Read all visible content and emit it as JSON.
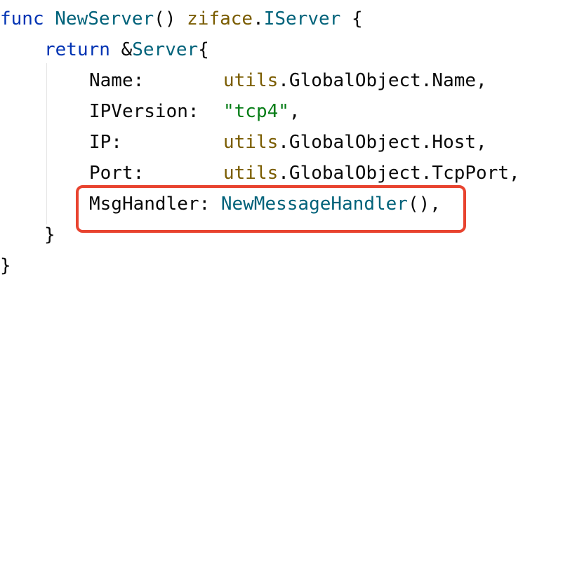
{
  "code": {
    "line1": {
      "kw_func": "func",
      "fn_name": "NewServer",
      "parens": "()",
      "pkg": "ziface",
      "dot": ".",
      "type": "IServer",
      "brace": "{"
    },
    "line2": {
      "kw_return": "return",
      "amp": "&",
      "type": "Server",
      "brace": "{"
    },
    "line3": {
      "field": "Name:",
      "pkg": "utils",
      "rest": ".GlobalObject.Name,"
    },
    "line4": {
      "field": "IPVersion:",
      "str": "\"tcp4\"",
      "comma": ","
    },
    "line5": {
      "field": "IP:",
      "pkg": "utils",
      "rest": ".GlobalObject.Host,"
    },
    "line6": {
      "field": "Port:",
      "pkg": "utils",
      "rest": ".GlobalObject.TcpPort,"
    },
    "line7": {
      "field": "MsgHandler:",
      "fn": "NewMessageHandler",
      "rest": "(),"
    },
    "line8": {
      "brace": "}"
    },
    "line9": {
      "brace": "}"
    }
  },
  "colors": {
    "keyword": "#0033b3",
    "function": "#00627a",
    "package": "#7a5c00",
    "string": "#067d17",
    "highlight_border": "#e8432f"
  }
}
